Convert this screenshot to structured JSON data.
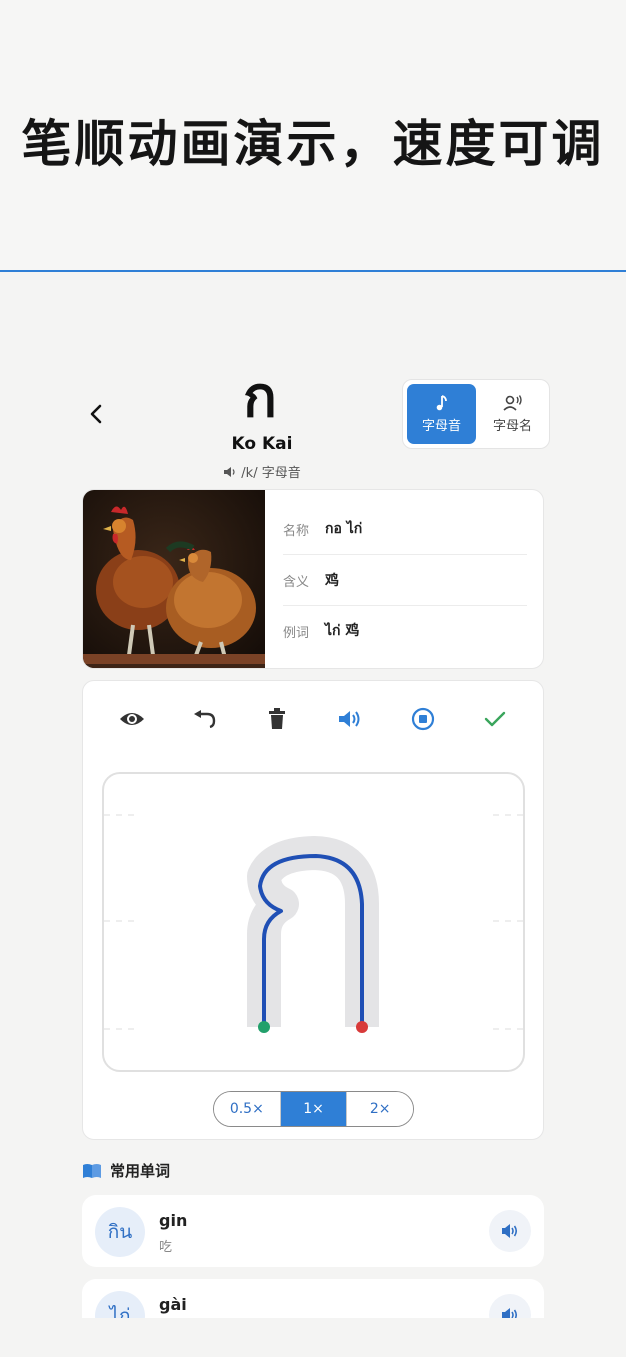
{
  "banner": {
    "title": "笔顺动画演示，速度可调"
  },
  "header": {
    "back_icon": "chevron-left-icon",
    "letter": "ก",
    "name": "Ko Kai",
    "sound": "/k/ 字母音",
    "sound_icon": "speaker-small-icon"
  },
  "mode_toggle": {
    "options": [
      {
        "label": "字母音",
        "icon": "music-note-icon",
        "active": true
      },
      {
        "label": "字母名",
        "icon": "person-voice-icon",
        "active": false
      }
    ],
    "accent": "#2f7fd6"
  },
  "info": {
    "image": "rooster-and-hen-photo",
    "rows": [
      {
        "label": "名称",
        "value": "กอ ไก่"
      },
      {
        "label": "含义",
        "value": "鸡"
      },
      {
        "label": "例词",
        "value": "ไก่  鸡"
      }
    ]
  },
  "toolbar": {
    "tools": [
      {
        "name": "eye-icon",
        "color": "#333333"
      },
      {
        "name": "undo-icon",
        "color": "#333333"
      },
      {
        "name": "trash-icon",
        "color": "#333333"
      },
      {
        "name": "speaker-icon",
        "color": "#2f7fd6"
      },
      {
        "name": "stop-icon",
        "color": "#2f7fd6"
      },
      {
        "name": "check-icon",
        "color": "#3aa55c"
      }
    ]
  },
  "stroke": {
    "start_color": "#22a06b",
    "end_color": "#d83a3a",
    "stroke_color": "#1f4fb5"
  },
  "speed": {
    "options": [
      "0.5×",
      "1×",
      "2×"
    ],
    "selected": "1×"
  },
  "words": {
    "heading": "常用单词",
    "heading_icon": "book-icon",
    "items": [
      {
        "thai": "กิน",
        "roman": "gin",
        "meaning": "吃"
      },
      {
        "thai": "ไก่",
        "roman": "gài",
        "meaning": ""
      }
    ]
  }
}
